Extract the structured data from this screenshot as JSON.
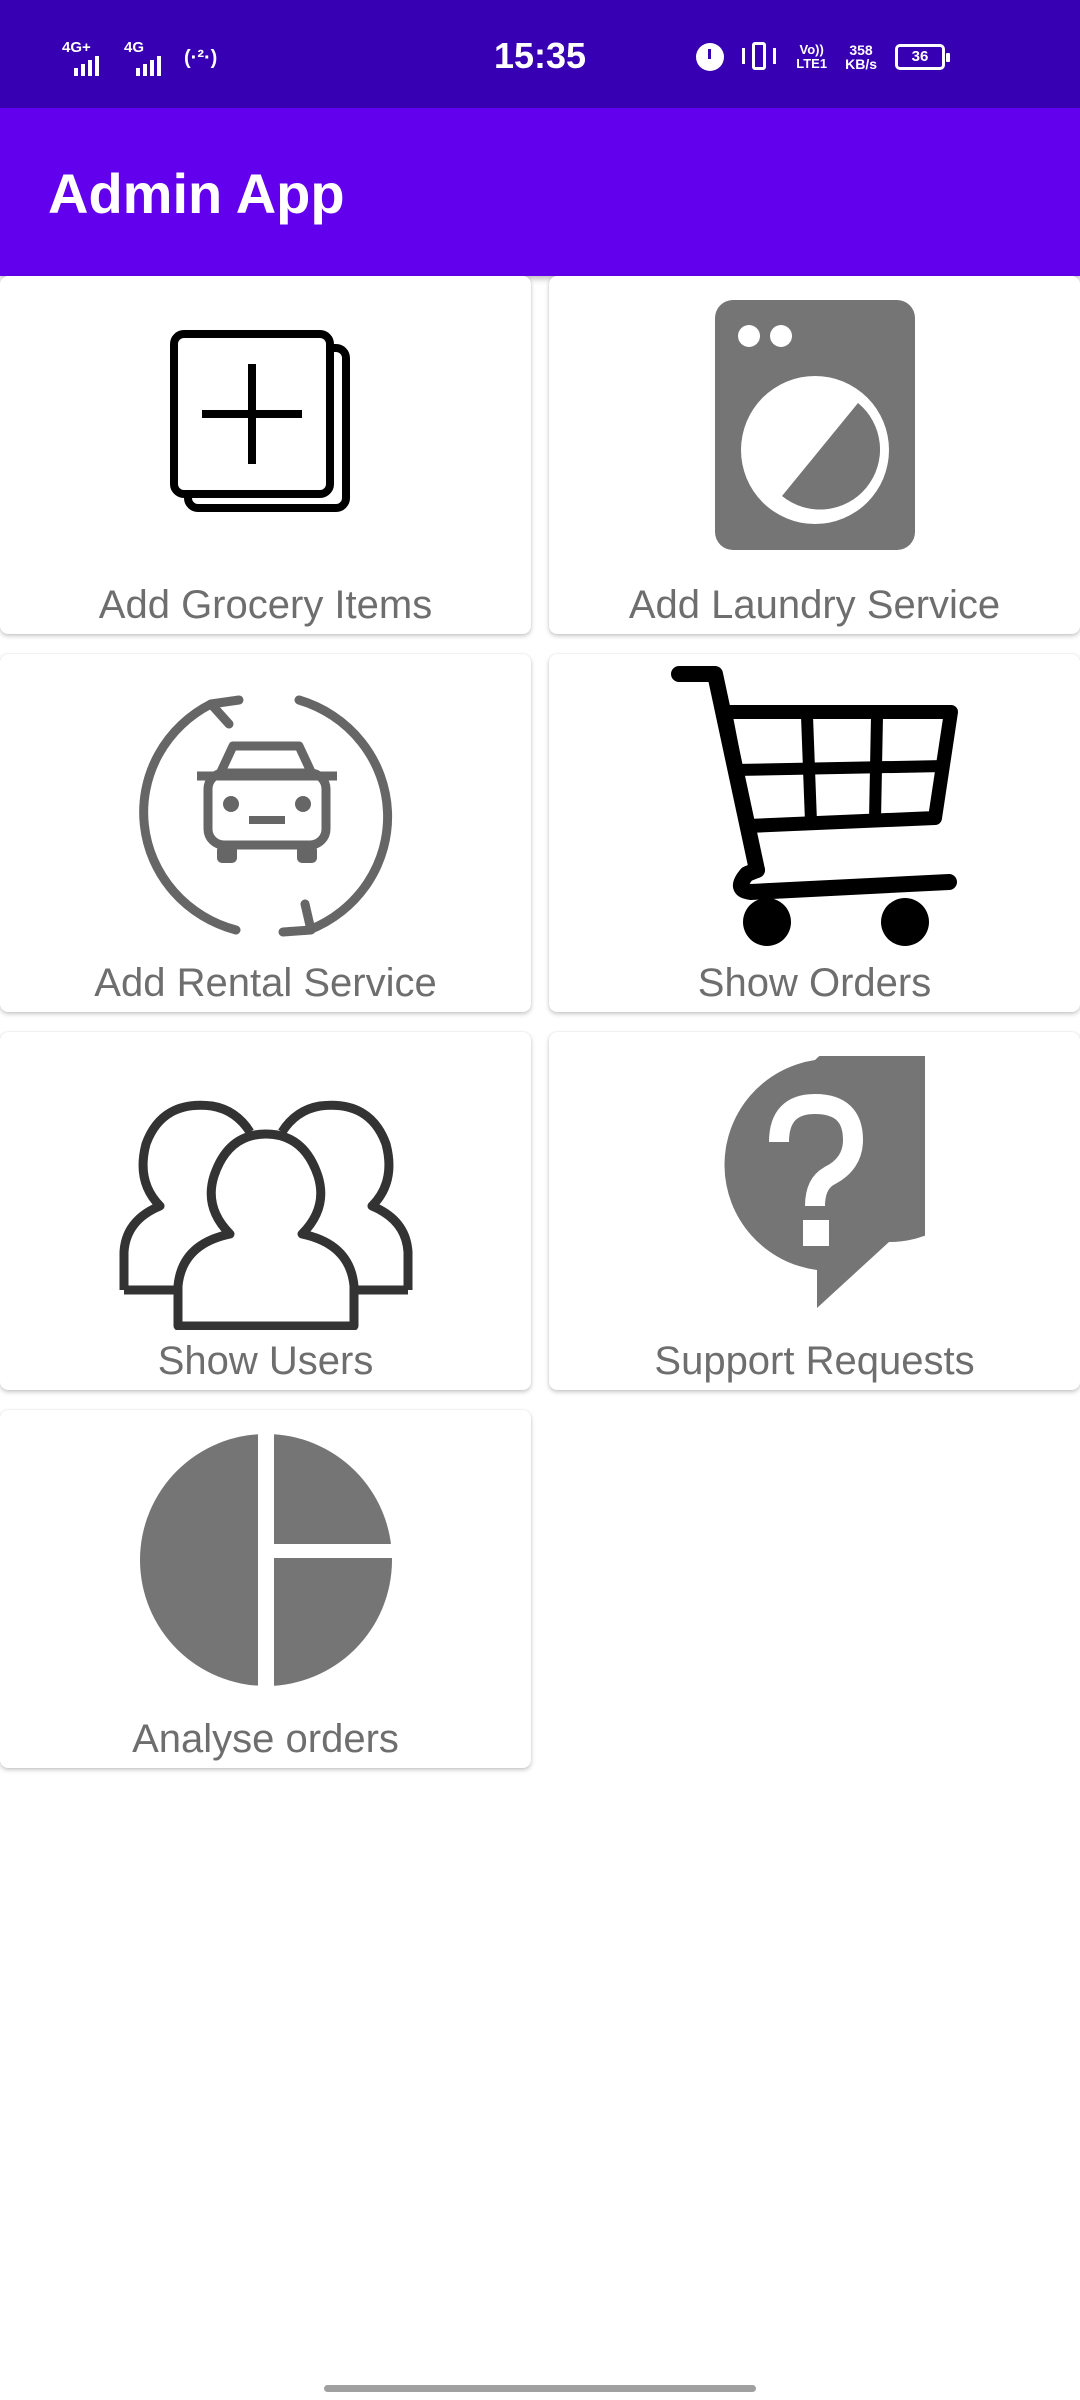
{
  "status_bar": {
    "time": "15:35",
    "sim1_network": "4G+",
    "sim2_network": "4G",
    "hotspot": "(·²·)",
    "volte_top": "Vo))",
    "volte_bottom": "LTE1",
    "speed_value": "358",
    "speed_unit": "KB/s",
    "battery_level": "36",
    "background_color": "#3700b3"
  },
  "app_bar": {
    "title": "Admin App",
    "background_color": "#6200ee"
  },
  "menu": {
    "items": [
      {
        "label": "Add Grocery Items",
        "icon": "add-box-icon"
      },
      {
        "label": "Add Laundry Service",
        "icon": "washing-machine-icon"
      },
      {
        "label": "Add Rental Service",
        "icon": "car-rental-icon"
      },
      {
        "label": "Show Orders",
        "icon": "shopping-cart-icon"
      },
      {
        "label": "Show Users",
        "icon": "users-group-icon"
      },
      {
        "label": "Support Requests",
        "icon": "help-bubble-icon"
      },
      {
        "label": "Analyse orders",
        "icon": "pie-chart-icon"
      }
    ],
    "label_color": "#6e6e6e",
    "icon_gray": "#757575"
  }
}
